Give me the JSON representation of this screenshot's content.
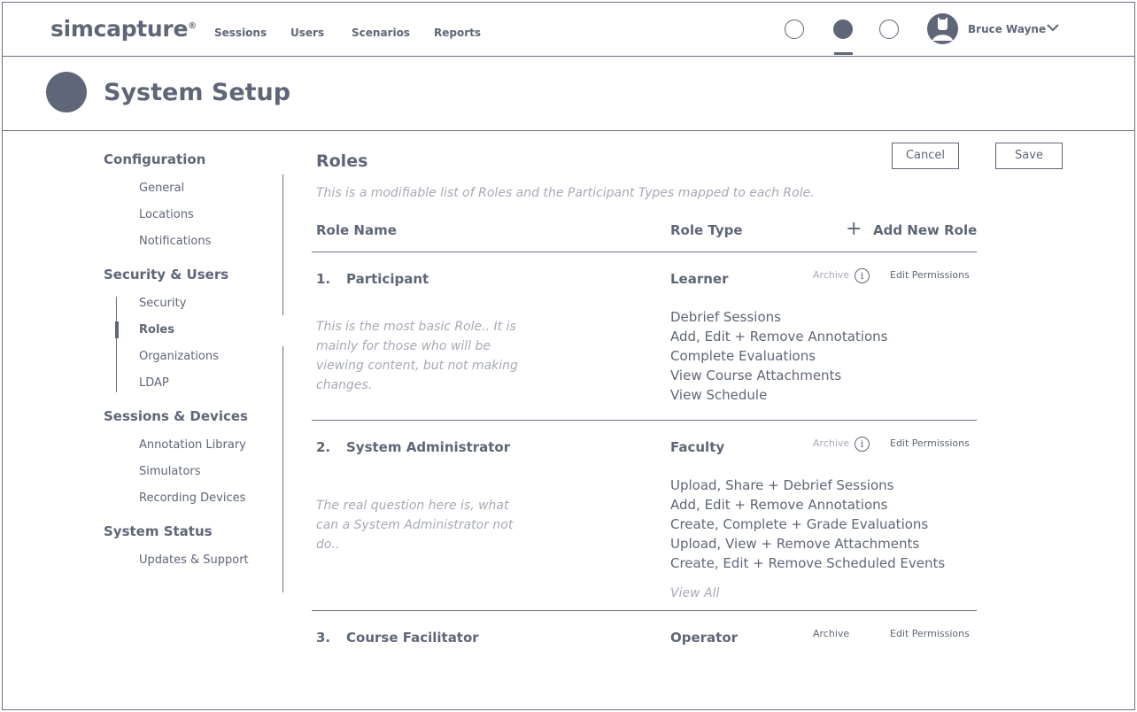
{
  "brand": {
    "name": "simcapture",
    "mark": "®"
  },
  "nav": {
    "links": [
      "Sessions",
      "Users",
      "Scenarios",
      "Reports"
    ]
  },
  "user": {
    "name": "Bruce Wayne"
  },
  "page": {
    "title": "System Setup"
  },
  "sidebar": {
    "sections": [
      {
        "title": "Configuration",
        "items": [
          "General",
          "Locations",
          "Notifications"
        ]
      },
      {
        "title": "Security & Users",
        "items": [
          "Security",
          "Roles",
          "Organizations",
          "LDAP"
        ]
      },
      {
        "title": "Sessions & Devices",
        "items": [
          "Annotation Library",
          "Simulators",
          "Recording Devices"
        ]
      },
      {
        "title": "System Status",
        "items": [
          "Updates & Support"
        ]
      }
    ],
    "active_item": "Roles"
  },
  "main": {
    "title": "Roles",
    "description": "This is a modifiable list of Roles and the Participant Types mapped to each Role.",
    "cancel_label": "Cancel",
    "save_label": "Save",
    "columns": {
      "role_name": "Role Name",
      "role_type": "Role Type"
    },
    "add_new_role": "Add New Role",
    "archive_label": "Archive",
    "edit_permissions_label": "Edit Permissions",
    "view_all_label": "View All",
    "roles": [
      {
        "number": "1.",
        "name": "Participant",
        "type": "Learner",
        "description": "This is the most basic Role.. It is mainly for those who will be viewing content, but not making changes.",
        "permissions": [
          "Debrief Sessions",
          "Add, Edit + Remove Annotations",
          "Complete Evaluations",
          "View Course Attachments",
          "View Schedule"
        ]
      },
      {
        "number": "2.",
        "name": "System Administrator",
        "type": "Faculty",
        "description": "The real question here is, what can a System Administrator not do..",
        "permissions": [
          "Upload, Share + Debrief Sessions",
          "Add, Edit + Remove Annotations",
          "Create, Complete + Grade Evaluations",
          "Upload, View + Remove Attachments",
          "Create, Edit + Remove Scheduled Events"
        ]
      },
      {
        "number": "3.",
        "name": "Course Facilitator",
        "type": "Operator"
      }
    ]
  }
}
